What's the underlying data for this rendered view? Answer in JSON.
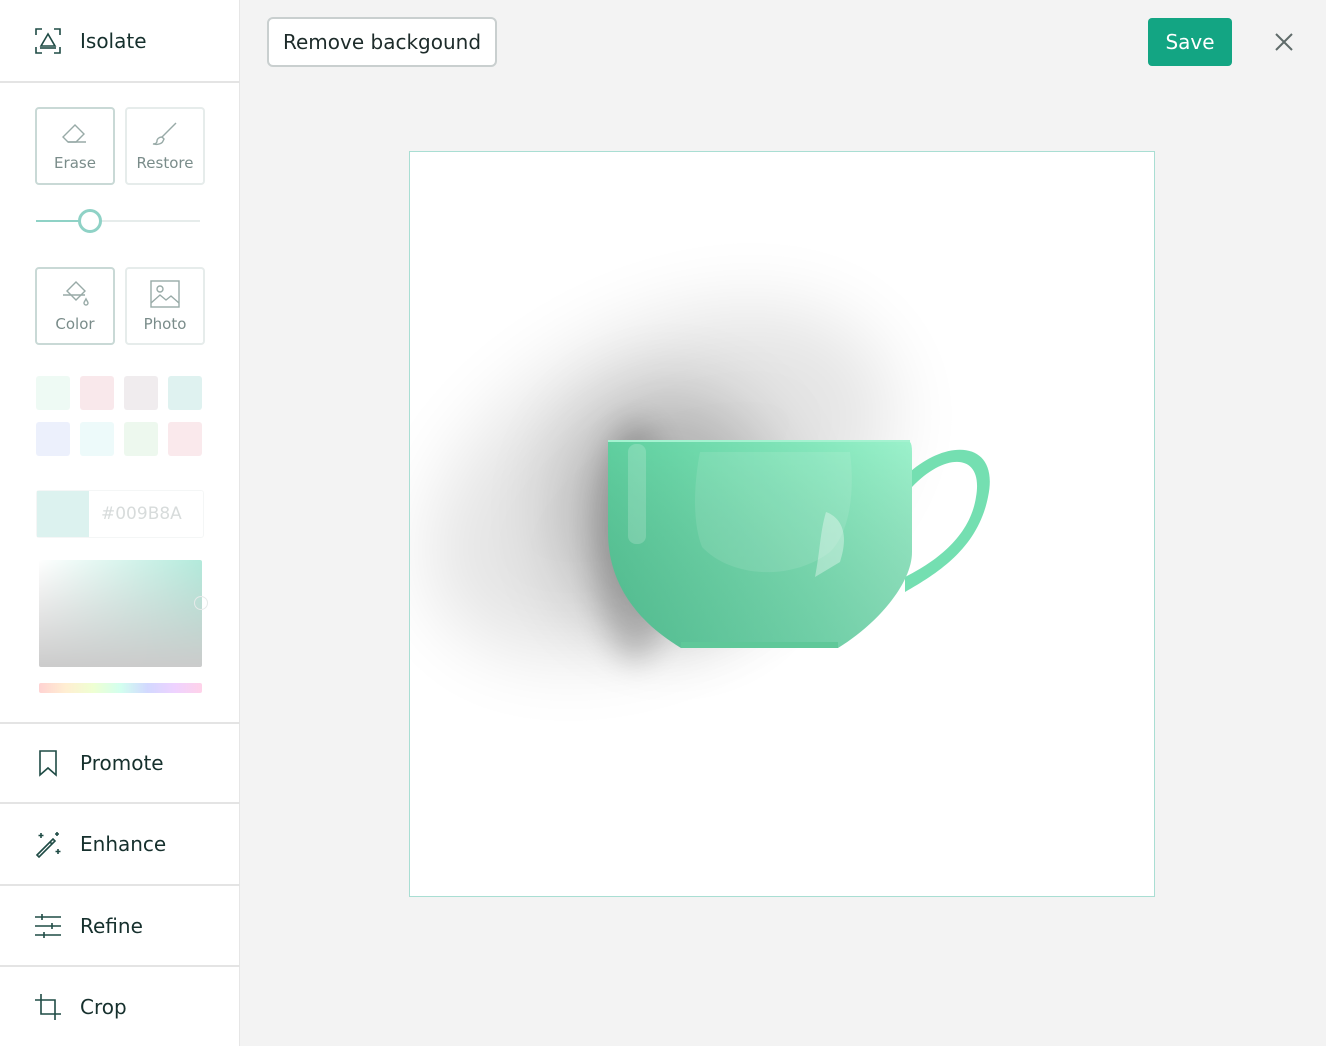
{
  "sidebar": {
    "isolate_label": "Isolate",
    "tools": {
      "erase_label": "Erase",
      "restore_label": "Restore",
      "color_label": "Color",
      "photo_label": "Photo"
    },
    "brush_size_fraction": 0.33,
    "swatches": [
      "#d9f3e6",
      "#f1cdd3",
      "#ddd5d9",
      "#b8e3de",
      "#d5def9",
      "#d8f4f3",
      "#d6f0da",
      "#f3cfd4"
    ],
    "hex_value": "#009B8A",
    "nav": {
      "promote_label": "Promote",
      "enhance_label": "Enhance",
      "refine_label": "Refine",
      "crop_label": "Crop"
    }
  },
  "toolbar": {
    "remove_background_label": "Remove backgound",
    "save_label": "Save"
  },
  "colors": {
    "accent": "#13a583",
    "canvas_border": "#a9ded3",
    "cup": "#7fe3b8"
  },
  "icons": [
    "isolate-icon",
    "eraser-icon",
    "brush-icon",
    "paint-bucket-icon",
    "image-icon",
    "bookmark-icon",
    "magic-wand-icon",
    "sliders-icon",
    "crop-icon",
    "close-icon"
  ]
}
